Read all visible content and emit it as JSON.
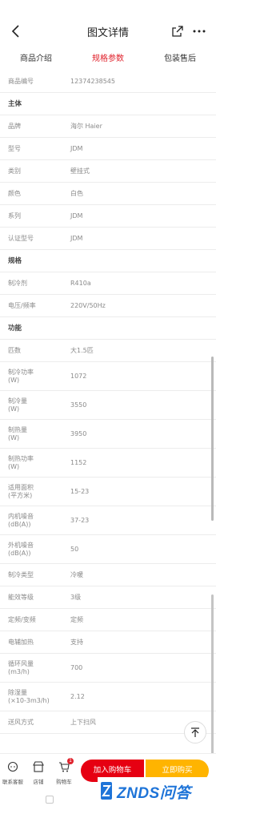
{
  "header": {
    "title": "图文详情"
  },
  "tabs": [
    {
      "label": "商品介绍",
      "active": false
    },
    {
      "label": "规格参数",
      "active": true
    },
    {
      "label": "包装售后",
      "active": false
    }
  ],
  "specs": [
    {
      "type": "row",
      "key": "商品编号",
      "value": "12374238545"
    },
    {
      "type": "section",
      "key": "主体"
    },
    {
      "type": "row",
      "key": "品牌",
      "value": "海尔 Haier"
    },
    {
      "type": "row",
      "key": "型号",
      "value": "JDM"
    },
    {
      "type": "row",
      "key": "类别",
      "value": "壁挂式"
    },
    {
      "type": "row",
      "key": "颜色",
      "value": "白色"
    },
    {
      "type": "row",
      "key": "系列",
      "value": "JDM"
    },
    {
      "type": "row",
      "key": "认证型号",
      "value": "JDM"
    },
    {
      "type": "section",
      "key": "规格"
    },
    {
      "type": "row",
      "key": "制冷剂",
      "value": "R410a"
    },
    {
      "type": "row",
      "key": "电压/频率",
      "value": "220V/50Hz"
    },
    {
      "type": "section",
      "key": "功能"
    },
    {
      "type": "row",
      "key": "匹数",
      "value": "大1.5匹"
    },
    {
      "type": "row",
      "key": "制冷功率\n(W)",
      "value": "1072"
    },
    {
      "type": "row",
      "key": "制冷量\n(W)",
      "value": "3550"
    },
    {
      "type": "row",
      "key": "制热量\n(W)",
      "value": "3950"
    },
    {
      "type": "row",
      "key": "制热功率\n(W)",
      "value": "1152"
    },
    {
      "type": "row",
      "key": "适用面积\n(平方米)",
      "value": "15-23"
    },
    {
      "type": "row",
      "key": "内机噪音\n(dB(A))",
      "value": "37-23"
    },
    {
      "type": "row",
      "key": "外机噪音\n(dB(A))",
      "value": "50"
    },
    {
      "type": "row",
      "key": "制冷类型",
      "value": "冷暖"
    },
    {
      "type": "row",
      "key": "能效等级",
      "value": "3级"
    },
    {
      "type": "row",
      "key": "定频/变频",
      "value": "定频"
    },
    {
      "type": "row",
      "key": "电辅加热",
      "value": "支持"
    },
    {
      "type": "row",
      "key": "循环风量\n(m3/h)",
      "value": "700"
    },
    {
      "type": "row",
      "key": "除湿量\n(×10-3m3/h)",
      "value": "2.12"
    },
    {
      "type": "row",
      "key": "送风方式",
      "value": "上下扫风"
    }
  ],
  "bottom": {
    "service_label": "联系客服",
    "shop_label": "店铺",
    "cart_label": "购物车",
    "cart_badge": "1",
    "add_to_cart": "加入购物车",
    "buy_now": "立即购买"
  },
  "watermark": {
    "text": "ZNDS问答"
  }
}
